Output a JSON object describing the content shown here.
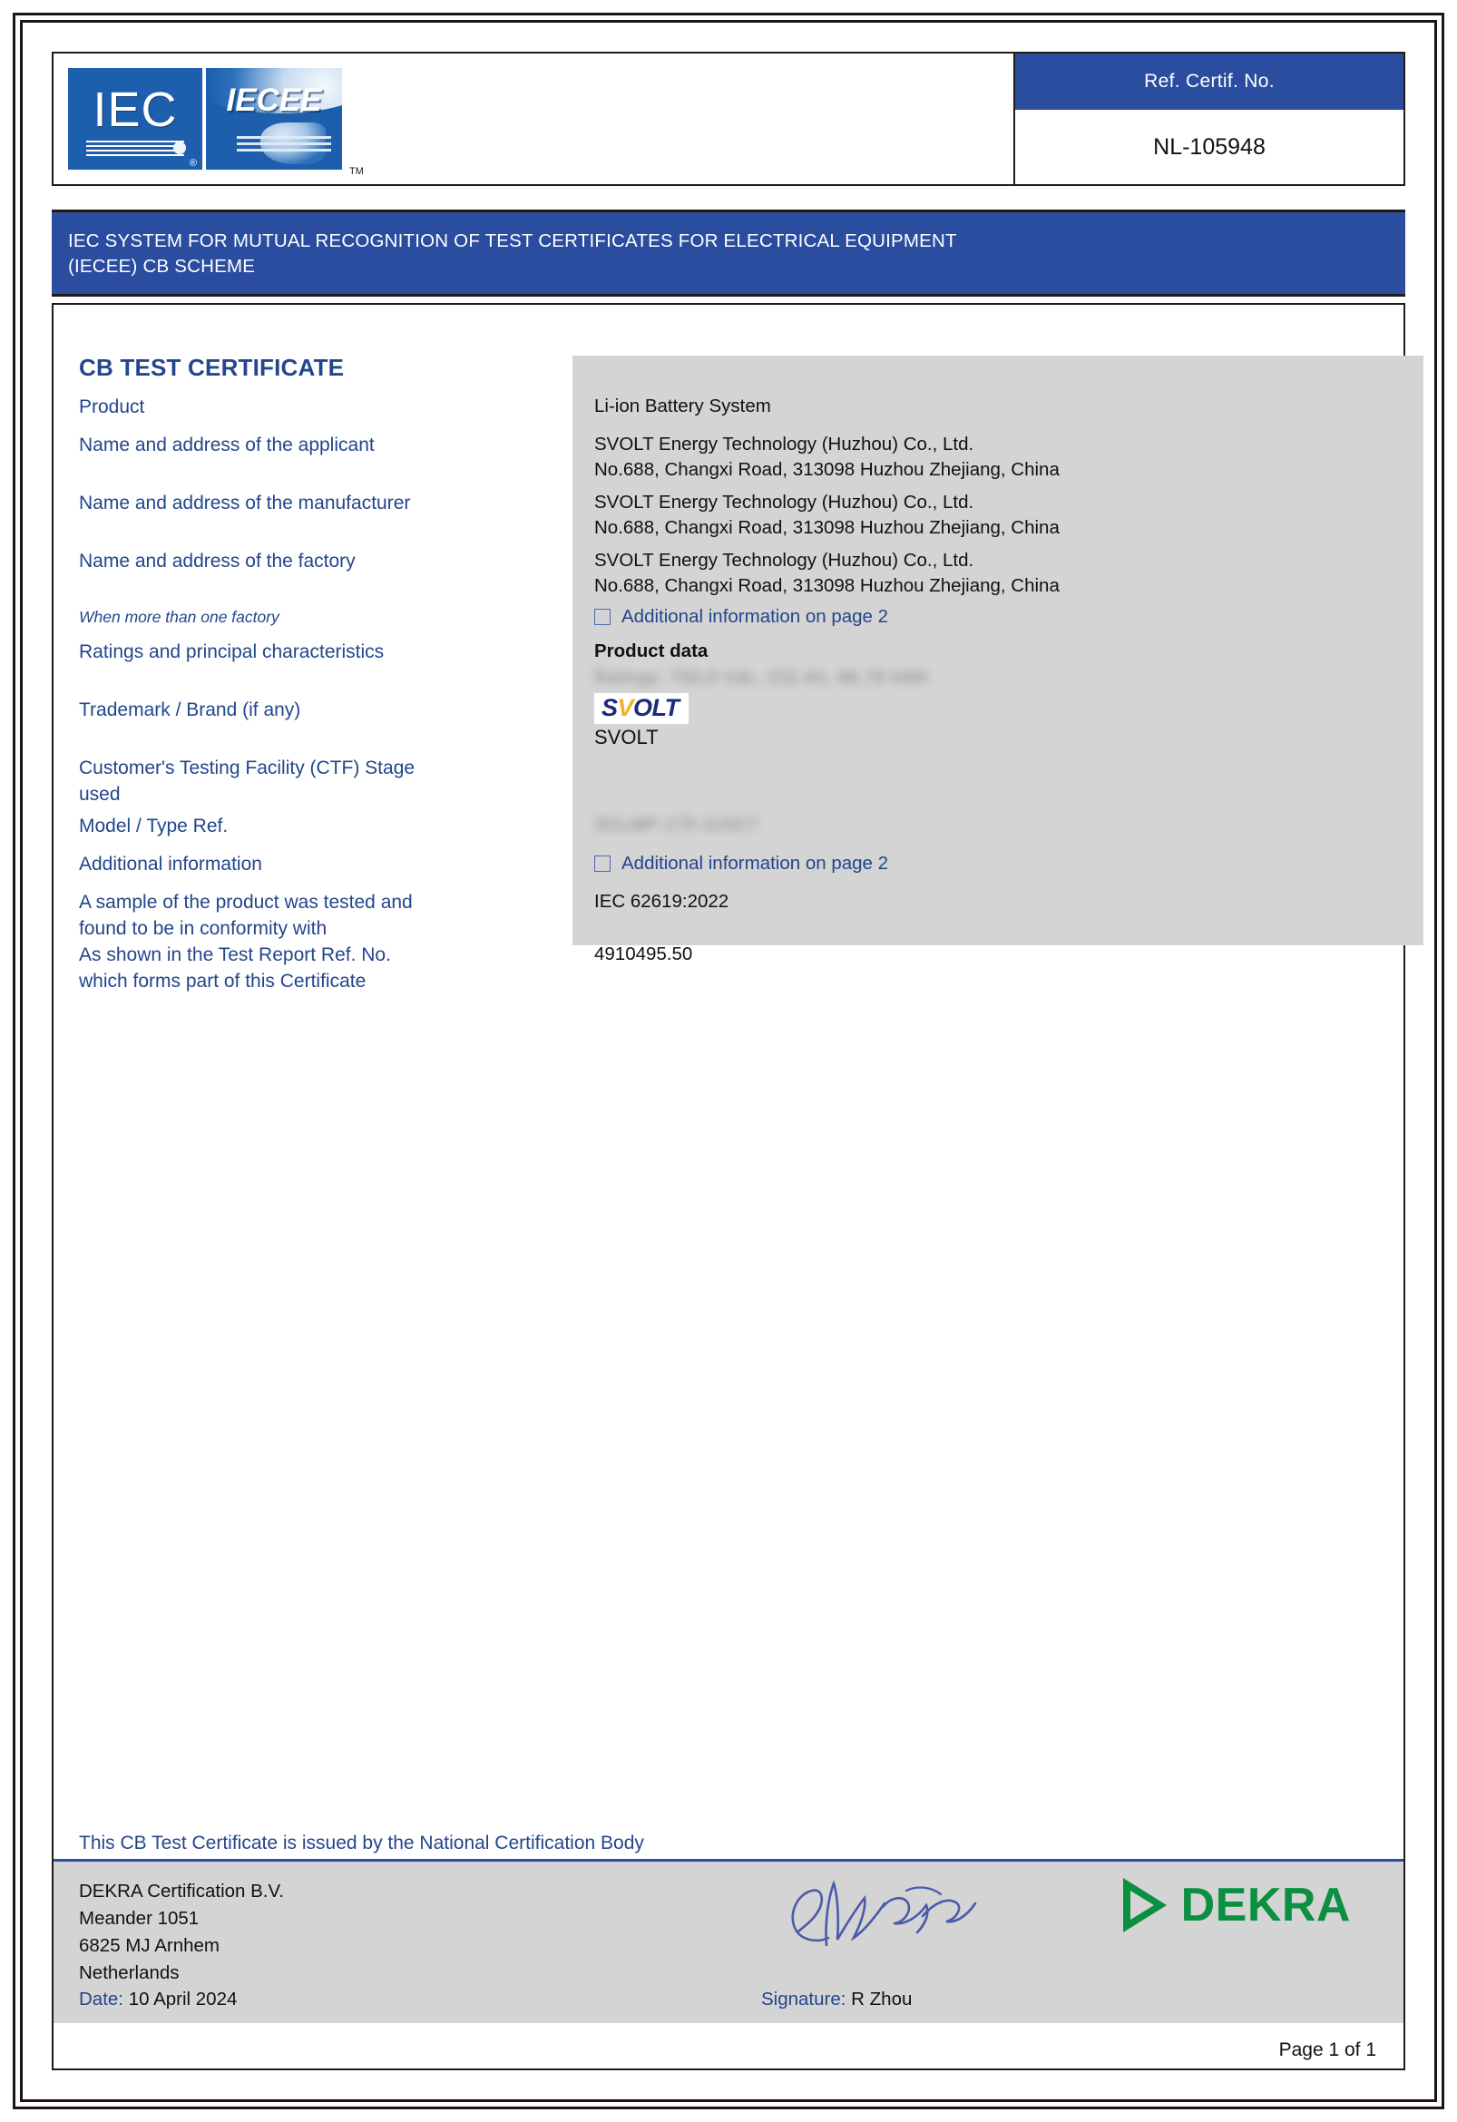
{
  "header": {
    "iec_logo_text": "IEC",
    "iecee_logo_text": "IECEE",
    "registered_mark": "®",
    "tm_mark": "TM",
    "ref_label": "Ref. Certif. No.",
    "ref_value": "NL-105948"
  },
  "scheme_band": {
    "line1": "IEC SYSTEM FOR MUTUAL RECOGNITION OF TEST CERTIFICATES FOR ELECTRICAL EQUIPMENT",
    "line2": "(IECEE) CB SCHEME"
  },
  "certificate": {
    "title": "CB TEST CERTIFICATE",
    "labels": {
      "product": "Product",
      "applicant": "Name and address of the applicant",
      "manufacturer": "Name and address of the manufacturer",
      "factory": "Name and address of the factory",
      "when_more_than_one_factory": "When more than one factory",
      "ratings": "Ratings and principal characteristics",
      "trademark": "Trademark / Brand (if any)",
      "ctf_stage_line1": "Customer's Testing Facility (CTF) Stage",
      "ctf_stage_line2": "used",
      "model_type_ref": "Model / Type Ref.",
      "additional_information": "Additional information",
      "conformity_line1": "A sample of the product was tested and",
      "conformity_line2": "found to be in conformity with",
      "test_report_line1": "As shown in the Test Report Ref. No.",
      "test_report_line2": "which forms part of this Certificate"
    },
    "values": {
      "product": "Li-ion Battery System",
      "applicant_name": "SVOLT Energy Technology (Huzhou) Co., Ltd.",
      "applicant_address": "No.688, Changxi Road, 313098  Huzhou Zhejiang, China",
      "manufacturer_name": "SVOLT Energy Technology (Huzhou) Co., Ltd.",
      "manufacturer_address": "No.688, Changxi Road, 313098  Huzhou Zhejiang, China",
      "factory_name": "SVOLT Energy Technology (Huzhou) Co., Ltd.",
      "factory_address": "No.688, Changxi Road, 313098  Huzhou Zhejiang, China",
      "additional_info_page2": "Additional information on page 2",
      "product_data_heading": "Product data",
      "product_data_redacted": "Ratings: 700,0 Vdc, 232 Ah, 86,78 kWh",
      "trademark_logo_s": "S",
      "trademark_logo_v": "V",
      "trademark_logo_olt": "OLT",
      "trademark_word": "SVOLT",
      "model_type_redacted": "SCLMP-175-11SC7",
      "additional_info_page2_b": "Additional information on page 2",
      "standard": "IEC 62619:2022",
      "test_report_no": "4910495.50"
    }
  },
  "footer": {
    "issued_by": "This CB Test Certificate is issued by the National Certification Body",
    "body_name": "DEKRA Certification B.V.",
    "address_line1": "Meander 1051",
    "address_line2": "6825 MJ  Arnhem",
    "address_line3": "Netherlands",
    "date_label": "Date:",
    "date_value": "10 April 2024",
    "signature_label": "Signature:",
    "signature_value": "R Zhou",
    "dekra_word": "DEKRA",
    "page_number": "Page 1 of 1"
  },
  "colors": {
    "brand_blue": "#2b4da0",
    "label_blue": "#23468c",
    "panel_grey": "#d4d4d4",
    "dekra_green": "#0a9040",
    "svolt_blue": "#1b2a7a",
    "svolt_yellow": "#f0b323"
  }
}
